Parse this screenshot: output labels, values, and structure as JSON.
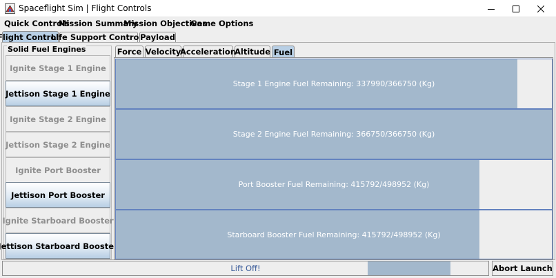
{
  "window": {
    "title": "Spaceflight Sim | Flight Controls"
  },
  "menu": [
    "Quick Controls",
    "Mission Summary",
    "Mission Objectives",
    "Game Options"
  ],
  "main_tabs": [
    {
      "label": "Flight Controls",
      "selected": true
    },
    {
      "label": "Life Support Controls",
      "selected": false
    },
    {
      "label": "Payload",
      "selected": false
    }
  ],
  "engines_group": {
    "title": "Solid Fuel Engines",
    "buttons": [
      {
        "label": "Ignite Stage 1 Engine",
        "enabled": false
      },
      {
        "label": "Jettison Stage 1 Engine",
        "enabled": true
      },
      {
        "label": "Ignite Stage 2 Engine",
        "enabled": false
      },
      {
        "label": "Jettison Stage 2 Engine",
        "enabled": false
      },
      {
        "label": "Ignite Port Booster",
        "enabled": false
      },
      {
        "label": "Jettison Port Booster",
        "enabled": true
      },
      {
        "label": "Ignite Starboard Booster",
        "enabled": false
      },
      {
        "label": "Jettison Starboard Booster",
        "enabled": true
      }
    ]
  },
  "sub_tabs": [
    {
      "label": "Force",
      "selected": false
    },
    {
      "label": "Velocity",
      "selected": false
    },
    {
      "label": "Acceleration",
      "selected": false
    },
    {
      "label": "Altitude",
      "selected": false
    },
    {
      "label": "Fuel",
      "selected": true
    }
  ],
  "fuel": [
    {
      "label": "Stage 1 Engine Fuel Remaining: 337990/366750 (Kg)",
      "remaining": 337990,
      "capacity": 366750
    },
    {
      "label": "Stage 2 Engine Fuel Remaining: 366750/366750 (Kg)",
      "remaining": 366750,
      "capacity": 366750
    },
    {
      "label": "Port Booster Fuel Remaining: 415792/498952 (Kg)",
      "remaining": 415792,
      "capacity": 498952
    },
    {
      "label": "Starboard Booster Fuel Remaining: 415792/498952 (Kg)",
      "remaining": 415792,
      "capacity": 498952
    }
  ],
  "status": {
    "text": "Lift Off!",
    "progress_start": 0.752,
    "progress_end": 0.922
  },
  "abort_label": "Abort Launch",
  "colors": {
    "accent": "#b8cfe5",
    "progress_fill": "#a3b8cc",
    "progress_border": "#6382bf",
    "status_text": "#3c5d9a"
  }
}
